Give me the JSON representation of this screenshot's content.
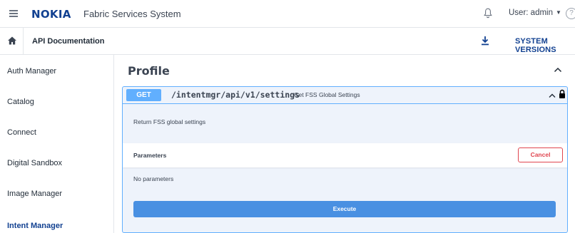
{
  "header": {
    "brand": "NOKIA",
    "app_title": "Fabric Services System",
    "user_label": "User: admin",
    "icons": {
      "menu": "hamburger-menu-icon",
      "notifications": "bell-icon",
      "help": "help-icon"
    },
    "help_glyph": "?"
  },
  "subbar": {
    "breadcrumb": "API Documentation",
    "system_versions": "SYSTEM VERSIONS",
    "icons": {
      "home": "home-icon",
      "download": "download-icon"
    }
  },
  "sidebar": {
    "items": [
      {
        "label": "Auth Manager",
        "active": false
      },
      {
        "label": "Catalog",
        "active": false
      },
      {
        "label": "Connect",
        "active": false
      },
      {
        "label": "Digital Sandbox",
        "active": false
      },
      {
        "label": "Image Manager",
        "active": false
      },
      {
        "label": "Intent Manager",
        "active": true
      }
    ]
  },
  "main": {
    "section_title": "Profile",
    "operation": {
      "method": "GET",
      "path": "/intentmgr/api/v1/settings",
      "summary": "Get FSS Global Settings",
      "description": "Return FSS global settings",
      "parameters_title": "Parameters",
      "cancel_label": "Cancel",
      "no_parameters": "No parameters",
      "execute_label": "Execute"
    }
  },
  "colors": {
    "brand": "#124191",
    "get_method": "#61affe",
    "operation_bg": "#eef3fb",
    "cancel": "#e0454f",
    "execute": "#4990e2",
    "active_nav": "#124191"
  }
}
